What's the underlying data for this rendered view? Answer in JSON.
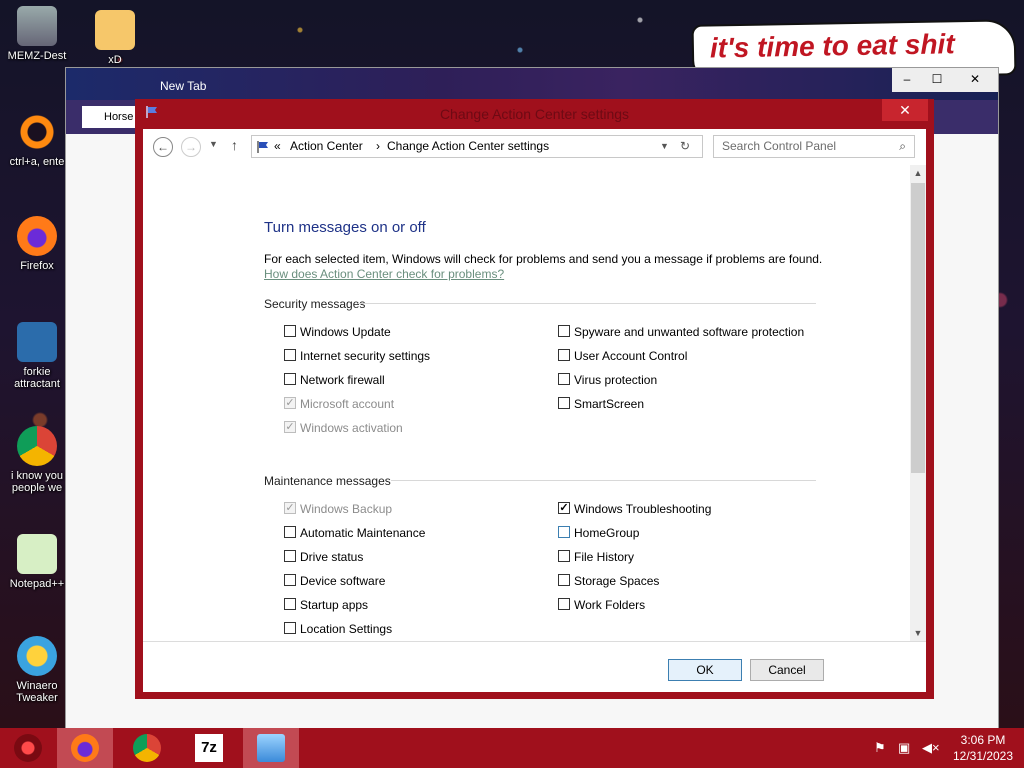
{
  "desktop": {
    "icons": [
      {
        "label": "MEMZ-Dest"
      },
      {
        "label": "xD"
      },
      {
        "label": "ctrl+a, ente"
      },
      {
        "label": "Firefox"
      },
      {
        "label": "forkie attractant"
      },
      {
        "label": "i know you people we"
      },
      {
        "label": "Notepad++"
      },
      {
        "label": "Winaero Tweaker"
      }
    ],
    "banner_text": "it's time to eat shit"
  },
  "browser": {
    "tab_title": "New Tab",
    "back_label": "Horse",
    "controls": {
      "minimize": "–",
      "maximize": "☐",
      "close": "✕"
    }
  },
  "dialog": {
    "title": "Change Action Center settings",
    "close": "✕",
    "address": {
      "prefix": "«",
      "crumb1": "Action Center",
      "sep": "›",
      "crumb2": "Change Action Center settings"
    },
    "search_placeholder": "Search Control Panel",
    "heading": "Turn messages on or off",
    "description": "For each selected item, Windows will check for problems and send you a message if problems are found.",
    "help_link": "How does Action Center check for problems?",
    "security": {
      "title": "Security messages",
      "left": [
        {
          "label": "Windows Update",
          "checked": false,
          "disabled": false
        },
        {
          "label": "Internet security settings",
          "checked": false,
          "disabled": false
        },
        {
          "label": "Network firewall",
          "checked": false,
          "disabled": false
        },
        {
          "label": "Microsoft account",
          "checked": true,
          "disabled": true
        },
        {
          "label": "Windows activation",
          "checked": true,
          "disabled": true
        }
      ],
      "right": [
        {
          "label": "Spyware and unwanted software protection",
          "checked": false,
          "disabled": false
        },
        {
          "label": "User Account Control",
          "checked": false,
          "disabled": false
        },
        {
          "label": "Virus protection",
          "checked": false,
          "disabled": false
        },
        {
          "label": "SmartScreen",
          "checked": false,
          "disabled": false
        }
      ]
    },
    "maintenance": {
      "title": "Maintenance messages",
      "left": [
        {
          "label": "Windows Backup",
          "checked": true,
          "disabled": true
        },
        {
          "label": "Automatic Maintenance",
          "checked": false,
          "disabled": false
        },
        {
          "label": "Drive status",
          "checked": false,
          "disabled": false
        },
        {
          "label": "Device software",
          "checked": false,
          "disabled": false
        },
        {
          "label": "Startup apps",
          "checked": false,
          "disabled": false
        },
        {
          "label": "Location Settings",
          "checked": false,
          "disabled": false
        }
      ],
      "right": [
        {
          "label": "Windows Troubleshooting",
          "checked": true,
          "disabled": false
        },
        {
          "label": "HomeGroup",
          "checked": false,
          "disabled": false,
          "hover": true
        },
        {
          "label": "File History",
          "checked": false,
          "disabled": false
        },
        {
          "label": "Storage Spaces",
          "checked": false,
          "disabled": false
        },
        {
          "label": "Work Folders",
          "checked": false,
          "disabled": false
        }
      ]
    },
    "ok_label": "OK",
    "cancel_label": "Cancel"
  },
  "taskbar": {
    "apps": [
      "Firefox",
      "Chrome",
      "7-Zip",
      "Control Panel"
    ],
    "time": "3:06 PM",
    "date": "12/31/2023"
  },
  "colors": {
    "accent_red": "#a0101c",
    "heading_blue": "#1e3287",
    "link_color": "#6a8f7e"
  }
}
